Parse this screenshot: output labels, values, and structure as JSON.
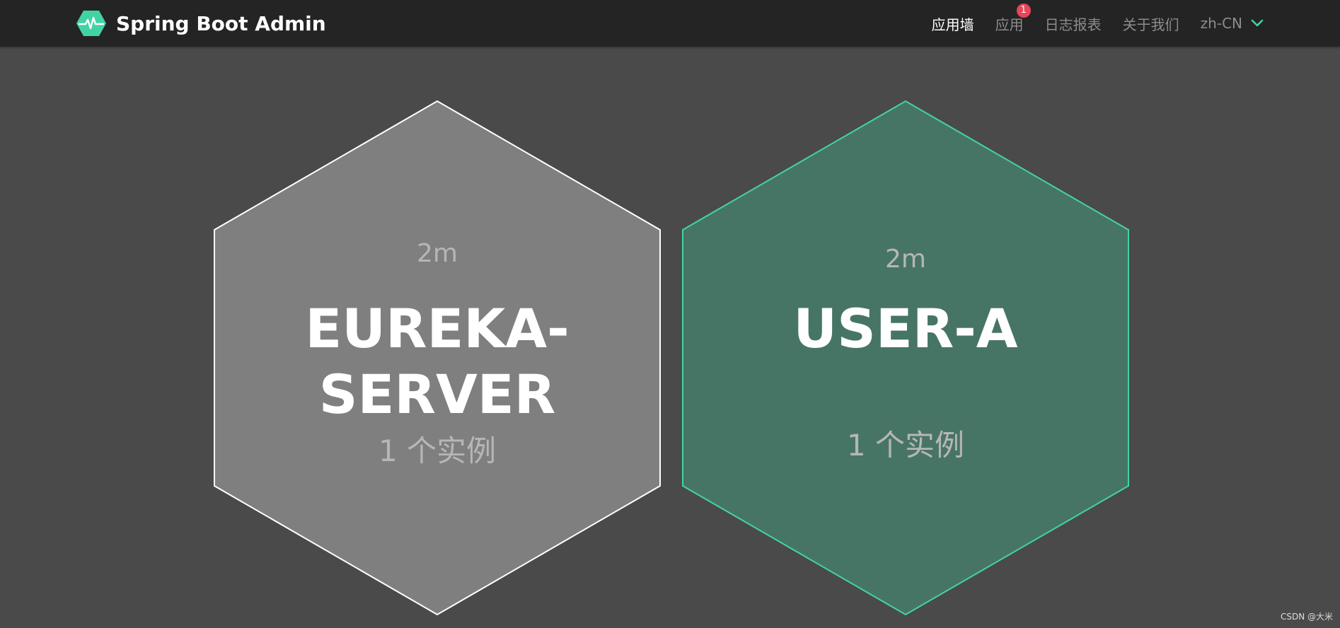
{
  "app": {
    "title": "Spring Boot Admin",
    "logo_icon": "heartbeat-hexagon-icon",
    "accent_color": "#42d3a5"
  },
  "nav": {
    "items": [
      {
        "label": "应用墙",
        "active": true
      },
      {
        "label": "应用",
        "badge": "1"
      },
      {
        "label": "日志报表"
      },
      {
        "label": "关于我们"
      }
    ],
    "language": {
      "label": "zh-CN",
      "icon": "chevron-down-icon"
    }
  },
  "applications": [
    {
      "time": "2m",
      "name": "EUREKA-SERVER",
      "instances": "1 个实例",
      "status_color": "#ffffff"
    },
    {
      "time": "2m",
      "name": "USER-A",
      "instances": "1 个实例",
      "status_color": "#42d3a5"
    }
  ],
  "watermark": "CSDN @大米"
}
